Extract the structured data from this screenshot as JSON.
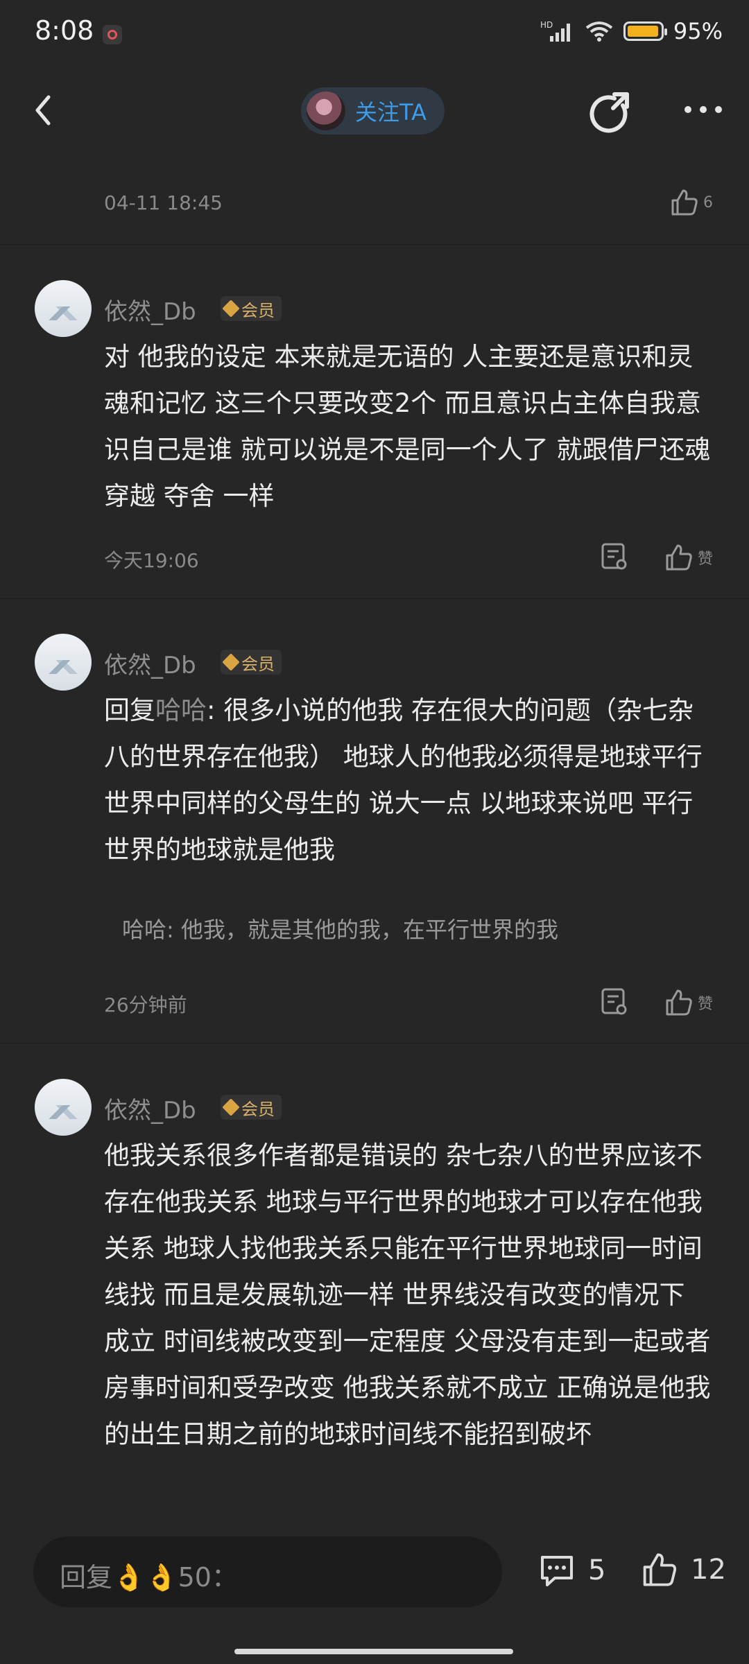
{
  "status_bar": {
    "time": "8:08",
    "network": "HD",
    "battery_percent": "95%"
  },
  "nav": {
    "follow_label": "关注TA"
  },
  "top_comment": {
    "timestamp": "04-11 18:45",
    "likes": "6"
  },
  "comments": [
    {
      "username": "依然_Db",
      "badge": "会员",
      "text": "对 他我的设定 本来就是无语的 人主要还是意识和灵魂和记忆 这三个只要改变2个 而且意识占主体自我意识自己是谁 就可以说是不是同一个人了 就跟借尸还魂 穿越 夺舍 一样",
      "time": "今天19:06",
      "like_label": "赞"
    },
    {
      "username": "依然_Db",
      "badge": "会员",
      "reply_prefix": "回复",
      "mention": "哈哈",
      "text": ": 很多小说的他我 存在很大的问题（杂七杂八的世界存在他我） 地球人的他我必须得是地球平行世界中同样的父母生的 说大一点 以地球来说吧 平行世界的地球就是他我",
      "quote_author": "哈哈",
      "quote_text": ": 他我，就是其他的我，在平行世界的我",
      "time": "26分钟前",
      "like_label": "赞"
    },
    {
      "username": "依然_Db",
      "badge": "会员",
      "text": "他我关系很多作者都是错误的 杂七杂八的世界应该不存在他我关系 地球与平行世界的地球才可以存在他我关系 地球人找他我关系只能在平行世界地球同一时间线找 而且是发展轨迹一样 世界线没有改变的情况下 成立 时间线被改变到一定程度 父母没有走到一起或者房事时间和受孕改变 他我关系就不成立 正确说是他我的出生日期之前的地球时间线不能招到破坏"
    }
  ],
  "bottom_bar": {
    "reply_placeholder": "回复👌👌50：",
    "comment_count": "5",
    "like_count": "12"
  },
  "colors": {
    "background": "#262626",
    "accent_blue": "#3d9be8",
    "vip_gold": "#d9b26a"
  }
}
